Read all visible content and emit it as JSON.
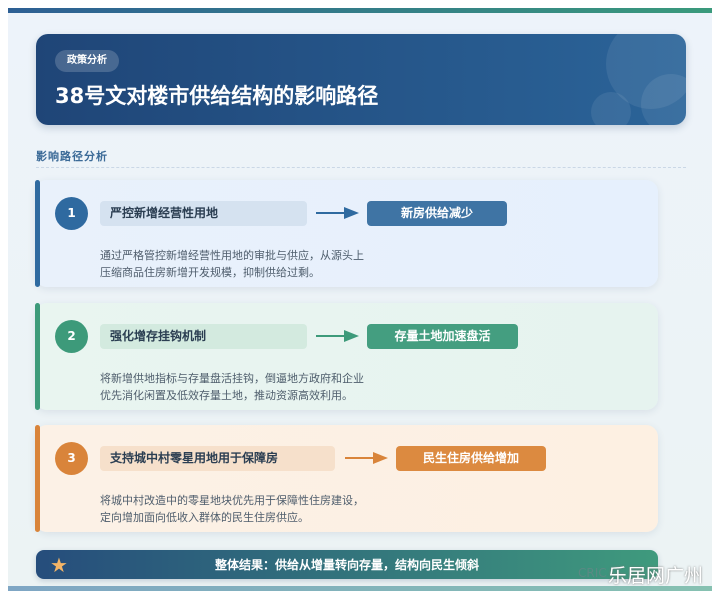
{
  "header": {
    "tag": "政策分析",
    "title": "38号文对楼市供给结构的影响路径"
  },
  "section_title": "影响路径分析",
  "steps": [
    {
      "number": "1",
      "label": "严控新增经营性用地",
      "result": "新房供给减少",
      "desc_lines": [
        "通过严格管控新增经营性用地的审批与供应，从源头上",
        "压缩商品住房新增开发规模，抑制供给过剩。"
      ],
      "color": "#2f6aa0"
    },
    {
      "number": "2",
      "label": "强化增存挂钩机制",
      "result": "存量土地加速盘活",
      "desc_lines": [
        "将新增供地指标与存量盘活挂钩，倒逼地方政府和企业",
        "优先消化闲置及低效存量土地，推动资源高效利用。"
      ],
      "color": "#3d9a7a"
    },
    {
      "number": "3",
      "label": "支持城中村零星用地用于保障房",
      "result": "民生住房供给增加",
      "desc_lines": [
        "将城中村改造中的零星地块优先用于保障性住房建设，",
        "定向增加面向低收入群体的民生住房供应。"
      ],
      "color": "#d9843a"
    }
  ],
  "footer": {
    "icon": "star-icon",
    "text": "整体结果：供给从增量转向存量，结构向民生倾斜"
  },
  "watermark": {
    "sub": "CRIC",
    "main": "乐居网广州"
  }
}
